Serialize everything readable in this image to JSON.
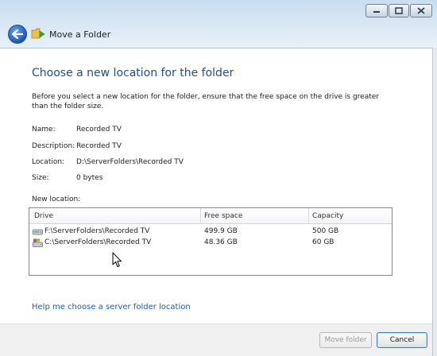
{
  "window": {
    "title": "Move a Folder",
    "caption_buttons": [
      "minimize-icon",
      "maximize-icon",
      "close-icon"
    ]
  },
  "page": {
    "heading": "Choose a new location for the folder",
    "intro": "Before you select a new location for the folder, ensure that the free space on the drive is greater than the folder size."
  },
  "details": {
    "name_label": "Name:",
    "name_value": "Recorded TV",
    "description_label": "Description:",
    "description_value": "Recorded TV",
    "location_label": "Location:",
    "location_value": "D:\\ServerFolders\\Recorded TV",
    "size_label": "Size:",
    "size_value": "0 bytes"
  },
  "new_location": {
    "label": "New location:",
    "columns": [
      "Drive",
      "Free space",
      "Capacity"
    ],
    "rows": [
      {
        "drive": "F:\\ServerFolders\\Recorded TV",
        "free": "499.9 GB",
        "capacity": "500 GB",
        "icon": "external-drive-icon"
      },
      {
        "drive": "C:\\ServerFolders\\Recorded TV",
        "free": "48.36 GB",
        "capacity": "60 GB",
        "icon": "system-drive-icon"
      }
    ]
  },
  "help_link": "Help me choose a server folder location",
  "buttons": {
    "move": "Move folder",
    "cancel": "Cancel"
  },
  "colors": {
    "heading": "#1f4e8a",
    "link": "#1f5ea8",
    "disabled_text": "#9a9a9a"
  }
}
